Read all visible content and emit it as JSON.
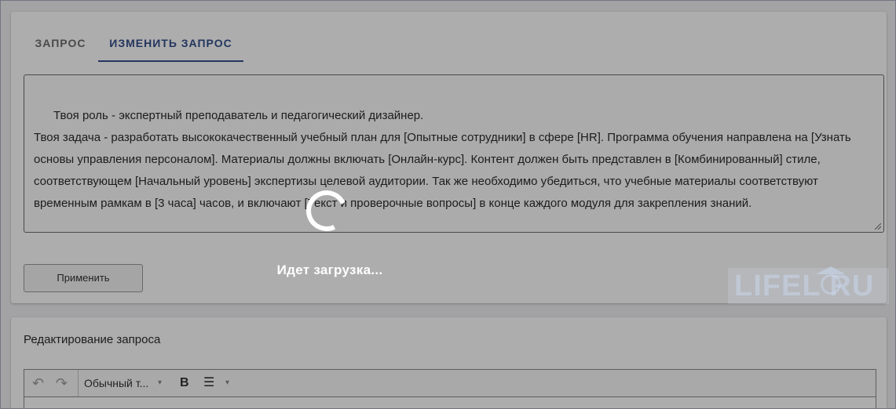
{
  "tabs": [
    {
      "label": "ЗАПРОС",
      "active": false
    },
    {
      "label": "ИЗМЕНИТЬ ЗАПРОС",
      "active": true
    }
  ],
  "prompt": {
    "text": "Твоя роль - экспертный преподаватель и педагогический дизайнер.\nТвоя задача - разработать высококачественный учебный план для [Опытные сотрудники] в сфере [HR]. Программа обучения направлена на [Узнать основы управления персоналом]. Материалы должны включать [Онлайн-курс]. Контент должен быть представлен в [Комбинированный] стиле, соответствующем [Начальный уровень] экспертизы целевой аудитории. Так же необходимо убедиться, что учебные материалы соответствуют временным рамкам в [3 часа] часов, и включают [Текст и проверочные вопросы] в конце каждого модуля для закрепления знаний."
  },
  "apply_button": {
    "label": "Применить"
  },
  "editor_card": {
    "title": "Редактирование запроса",
    "toolbar": {
      "undo_icon": "↶",
      "redo_icon": "↷",
      "format_label": "Обычный т...",
      "caret": "▾",
      "bold_label": "B",
      "list_icon": "☰"
    }
  },
  "loading": {
    "text": "Идет загрузка..."
  },
  "watermark": {
    "text": "LIFEL  RU"
  },
  "colors": {
    "accent": "#36508c",
    "overlay": "rgba(0,0,0,0.32)"
  }
}
